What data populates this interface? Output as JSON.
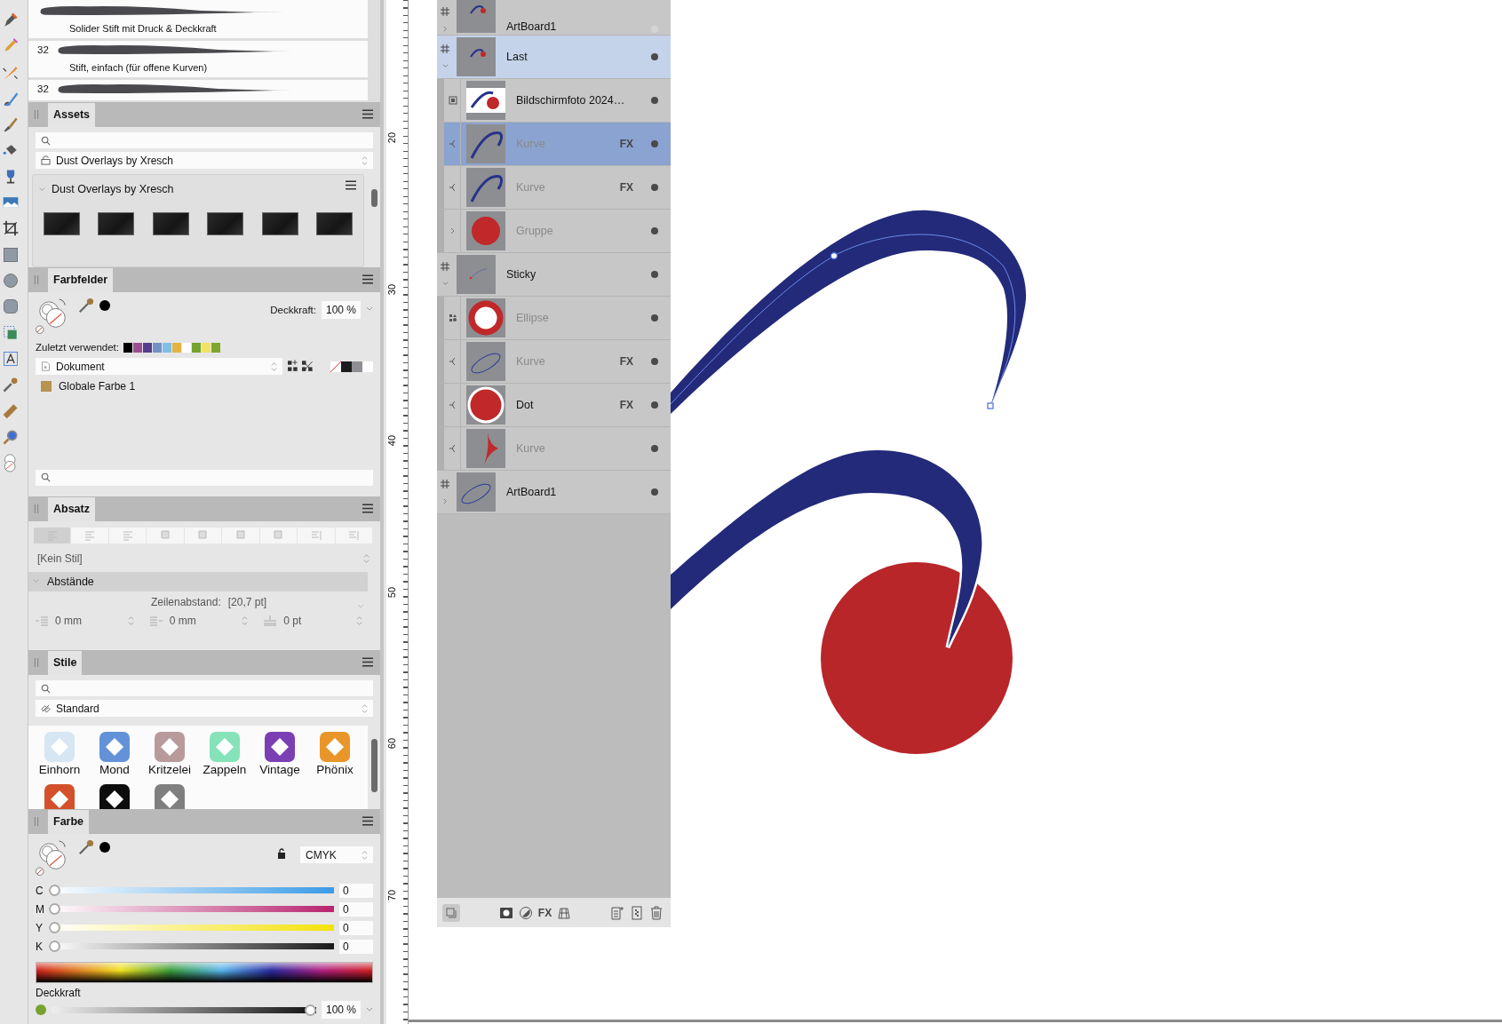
{
  "brushes": [
    {
      "label": "Solider Stift mit Druck & Deckkraft"
    },
    {
      "size": "32",
      "label": "Stift, einfach (für offene Kurven)"
    },
    {
      "size": "32"
    }
  ],
  "assets": {
    "title": "Assets",
    "category": "Dust Overlays by Xresch",
    "subcategory": "Dust Overlays by Xresch",
    "expanded": true,
    "thumbnails": [
      {
        "kind": "texture"
      },
      {
        "kind": "texture"
      },
      {
        "kind": "texture"
      },
      {
        "kind": "texture"
      },
      {
        "kind": "texture"
      },
      {
        "kind": "texture"
      }
    ]
  },
  "swatches_panel": {
    "title": "Farbfelder",
    "opacity_label": "Deckkraft:",
    "opacity": "100 %",
    "recent_label": "Zuletzt verwendet:",
    "recent_colors": [
      {
        "color": "#000000"
      },
      {
        "color": "#9b4e93"
      },
      {
        "color": "#553e8e"
      },
      {
        "color": "#7491c4"
      },
      {
        "color": "#7fbfe6"
      },
      {
        "color": "#e1b443"
      },
      {
        "color": "#ffffff"
      },
      {
        "color": "#76a22e"
      },
      {
        "color": "#efe264"
      },
      {
        "color": "#7da62e"
      }
    ],
    "palette": "Dokument",
    "quick_colors": [
      {
        "kind": "none"
      },
      {
        "kind": "color",
        "color": "#1c1c1e"
      },
      {
        "kind": "color",
        "color": "#8e8e93"
      },
      {
        "kind": "color",
        "color": "#ffffff"
      }
    ],
    "swatches": [
      {
        "name": "Globale Farbe 1",
        "color": "#b8934f"
      }
    ]
  },
  "paragraph": {
    "title": "Absatz",
    "alignments": [
      {
        "selected": true
      },
      {
        "selected": false
      },
      {
        "selected": false
      },
      {
        "selected": false
      },
      {
        "selected": false
      },
      {
        "selected": false
      },
      {
        "selected": false
      },
      {
        "selected": false
      },
      {
        "selected": false
      }
    ],
    "style": "[Kein Stil]",
    "section": "Abstände",
    "expanded": true,
    "line_spacing_label": "Zeilenabstand:",
    "line_spacing": "[20,7 pt]",
    "indents": [
      {
        "kind": "left",
        "value": "0 mm"
      },
      {
        "kind": "right",
        "value": "0 mm"
      },
      {
        "kind": "space",
        "value": "0 pt"
      }
    ]
  },
  "styles": {
    "title": "Stile",
    "category": "Standard",
    "items": [
      {
        "name": "Einhorn",
        "color": "#d6e6f3"
      },
      {
        "name": "Mond",
        "color": "#6492d8"
      },
      {
        "name": "Kritzelei",
        "color": "#b99a9c"
      },
      {
        "name": "Zappeln",
        "color": "#86e3b9"
      },
      {
        "name": "Vintage",
        "color": "#7b3fb3"
      },
      {
        "name": "Phönix",
        "color": "#e8962a"
      },
      {
        "color": "#d4502a"
      },
      {
        "color": "#0d0d0d"
      },
      {
        "color": "#7f7f7f"
      }
    ]
  },
  "color": {
    "title": "Farbe",
    "model": "CMYK",
    "sliders": [
      {
        "label": "C",
        "kind": "cyan",
        "level": 0,
        "value": "0"
      },
      {
        "label": "M",
        "kind": "magenta",
        "level": 0,
        "value": "0"
      },
      {
        "label": "Y",
        "kind": "yellow",
        "level": 0,
        "value": "0"
      },
      {
        "label": "K",
        "kind": "key",
        "level": 0,
        "value": "0"
      }
    ],
    "opacity": {
      "label": "Deckkraft",
      "level": 1,
      "value": "100 %"
    }
  },
  "ruler": {
    "labels": [
      "20",
      "30",
      "40",
      "50",
      "60",
      "70"
    ]
  },
  "layers": {
    "fx_button": "FX",
    "rows": [
      {
        "name": "ArtBoard1",
        "kind": "artboard",
        "thumbnail": {
          "kind": "mini-arc"
        },
        "expanded": false,
        "selected": false,
        "visible": false,
        "dimmed": false
      },
      {
        "name": "Last",
        "kind": "artboard",
        "thumbnail": {
          "kind": "mini-arc"
        },
        "expanded": true,
        "selected": true,
        "visible": true,
        "dimmed": false,
        "children": [
          {
            "name": "Bildschirmfoto 2024…",
            "kind": "image",
            "thumbnail": {
              "kind": "arc-circle"
            },
            "selected": false,
            "visible": true,
            "dimmed": false
          },
          {
            "name": "Kurve",
            "kind": "curve",
            "thumbnail": {
              "kind": "arc"
            },
            "fx": "FX",
            "selected": true,
            "visible": true,
            "dimmed": true
          },
          {
            "name": "Kurve",
            "kind": "curve",
            "thumbnail": {
              "kind": "arc"
            },
            "fx": "FX",
            "selected": false,
            "visible": true,
            "dimmed": true
          },
          {
            "name": "Gruppe",
            "kind": "group",
            "thumbnail": {
              "kind": "circle"
            },
            "selected": false,
            "visible": true,
            "dimmed": true
          }
        ]
      },
      {
        "name": "Sticky",
        "kind": "artboard",
        "thumbnail": {
          "kind": "sparse"
        },
        "expanded": true,
        "selected": false,
        "visible": true,
        "dimmed": false,
        "children": [
          {
            "name": "Ellipse",
            "kind": "ellipse",
            "thumbnail": {
              "kind": "ring"
            },
            "selected": false,
            "visible": true,
            "dimmed": true
          },
          {
            "name": "Kurve",
            "kind": "curve",
            "thumbnail": {
              "kind": "loop"
            },
            "fx": "FX",
            "selected": false,
            "visible": true,
            "dimmed": true
          },
          {
            "name": "Dot",
            "kind": "curve",
            "thumbnail": {
              "kind": "circle-outlined"
            },
            "fx": "FX",
            "selected": false,
            "visible": true,
            "dimmed": false
          },
          {
            "name": "Kurve",
            "kind": "curve",
            "thumbnail": {
              "kind": "wedge"
            },
            "selected": false,
            "visible": true,
            "dimmed": true
          }
        ]
      },
      {
        "name": "ArtBoard1",
        "kind": "artboard",
        "thumbnail": {
          "kind": "loop"
        },
        "expanded": false,
        "selected": false,
        "visible": true,
        "dimmed": false
      }
    ]
  }
}
